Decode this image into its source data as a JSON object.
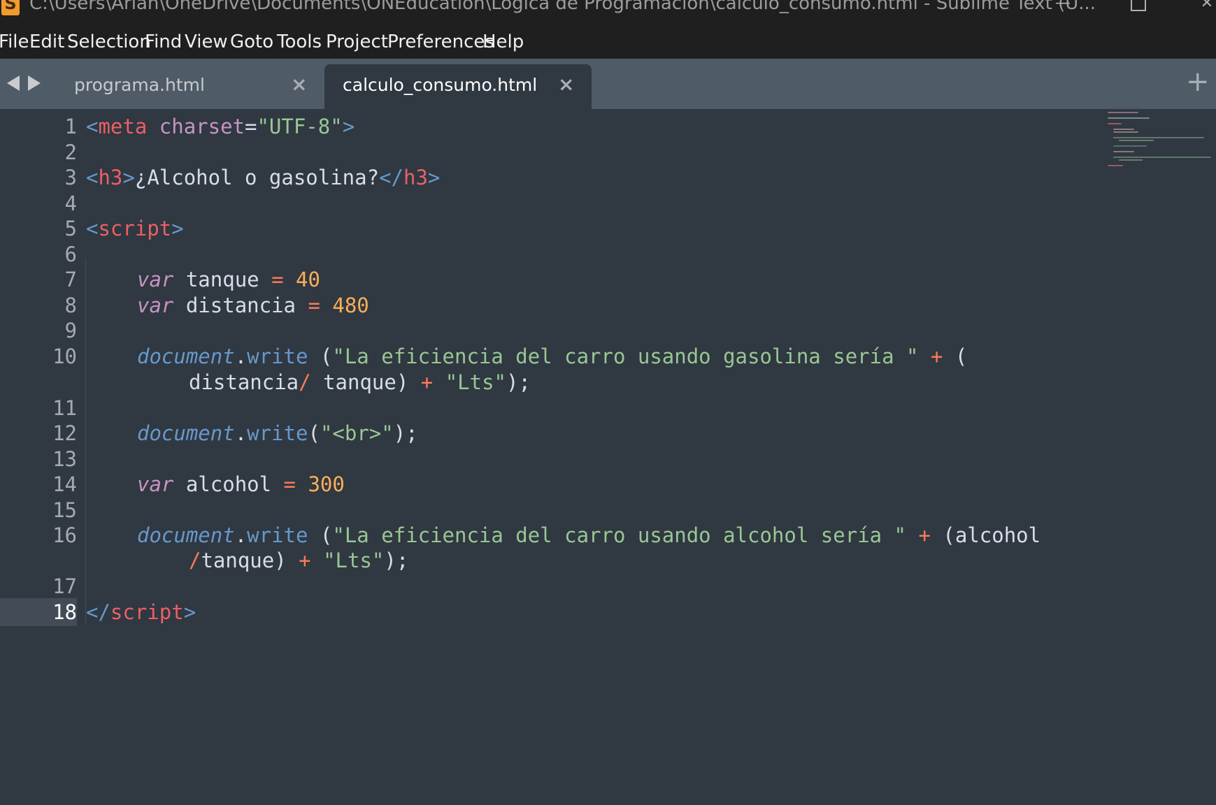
{
  "window": {
    "title": "C:\\Users\\Arian\\OneDrive\\Documents\\ONEducation\\Logica de Programacion\\calculo_consumo.html - Sublime Text (U...",
    "app_icon_glyph": "S",
    "minimize_glyph": "—",
    "close_glyph": "✕"
  },
  "menu": [
    "File",
    "Edit",
    "Selection",
    "Find",
    "View",
    "Goto",
    "Tools",
    "Project",
    "Preferences",
    "Help"
  ],
  "tabs": [
    {
      "label": "programa.html",
      "active": false,
      "close_glyph": "×"
    },
    {
      "label": "calculo_consumo.html",
      "active": true,
      "close_glyph": "×"
    }
  ],
  "new_tab_glyph": "+",
  "line_numbers": [
    "1",
    "2",
    "3",
    "4",
    "5",
    "6",
    "7",
    "8",
    "9",
    "10",
    "11",
    "12",
    "13",
    "14",
    "15",
    "16",
    "17",
    "18"
  ],
  "current_line": "18",
  "code": {
    "l1": {
      "lt": "<",
      "tag": "meta",
      "attr": "charset",
      "eq": "=",
      "val": "\"UTF-8\"",
      "gt": ">"
    },
    "l3": {
      "open": "<",
      "tag": "h3",
      "gt": ">",
      "text": "¿Alcohol o gasolina?",
      "close_open": "</",
      "close_tag": "h3",
      "close_gt": ">"
    },
    "l5": {
      "lt": "<",
      "tag": "script",
      "gt": ">"
    },
    "l7": {
      "kw": "var",
      "name": " tanque ",
      "op": "=",
      "num": "40"
    },
    "l8": {
      "kw": "var",
      "name": " distancia ",
      "op": "=",
      "num": "480"
    },
    "l10": {
      "obj": "document",
      "dot": ".",
      "fn": "write",
      "p1": " (",
      "str": "\"La eficiencia del carro usando gasolina sería \"",
      "plus": "+",
      "p2": " ("
    },
    "l10b": {
      "a": "distancia",
      "op": "/",
      "b": " tanque) ",
      "plus": "+",
      "str": "\"Lts\"",
      "end": ");"
    },
    "l12": {
      "obj": "document",
      "dot": ".",
      "fn": "write",
      "p1": "(",
      "str": "\"<br>\"",
      "end": ");"
    },
    "l14": {
      "kw": "var",
      "name": " alcohol ",
      "op": "=",
      "num": "300"
    },
    "l16": {
      "obj": "document",
      "dot": ".",
      "fn": "write",
      "p1": " (",
      "str": "\"La eficiencia del carro usando alcohol sería \"",
      "plus": "+",
      "p2": " (alcohol"
    },
    "l16b": {
      "op": "/",
      "b": "tanque) ",
      "plus": "+",
      "str": "\"Lts\"",
      "end": ");"
    },
    "l18": {
      "lt": "</",
      "tag": "script",
      "gt": ">"
    }
  },
  "colors": {
    "background": "#303841",
    "tag": "#ec5f67",
    "string": "#99c794",
    "keyword": "#c594c5",
    "number": "#f9ae58",
    "operator": "#f97b58",
    "function": "#6699cc"
  }
}
